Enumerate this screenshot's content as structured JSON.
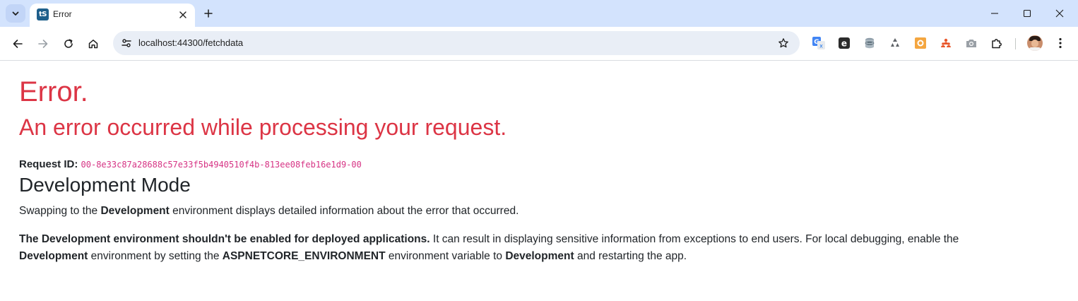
{
  "browser": {
    "tab": {
      "favicon_text": "tS",
      "title": "Error"
    },
    "address_bar": {
      "url": "localhost:44300/fetchdata"
    },
    "extensions": [
      "translate-icon",
      "edge-e-icon",
      "database-icon",
      "recycle-icon",
      "orange-box-icon",
      "people-icon",
      "camera-icon",
      "puzzle-icon"
    ]
  },
  "page": {
    "title": "Error.",
    "subtitle": "An error occurred while processing your request.",
    "request": {
      "label": "Request ID:",
      "id": "00-8e33c87a28688c57e33f5b4940510f4b-813ee08feb16e1d9-00"
    },
    "dev_heading": "Development Mode",
    "p1": {
      "before": "Swapping to the ",
      "bold": "Development",
      "after": " environment displays detailed information about the error that occurred."
    },
    "p2": {
      "bold1": "The Development environment shouldn't be enabled for deployed applications.",
      "text1": " It can result in displaying sensitive information from exceptions to end users. For local debugging, enable the ",
      "bold2": "Development",
      "text2": " environment by setting the ",
      "bold3": "ASPNETCORE_ENVIRONMENT",
      "text3": " environment variable to ",
      "bold4": "Development",
      "text4": " and restarting the app."
    }
  },
  "colors": {
    "error_red": "#dc3545",
    "code_pink": "#d63384",
    "titlebar": "#d3e3fd",
    "omnibox": "#e9eef6"
  }
}
